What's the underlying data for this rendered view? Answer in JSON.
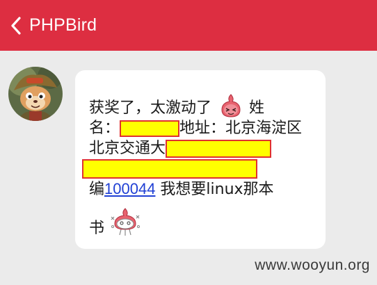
{
  "header": {
    "title": "PHPBird",
    "back_icon": "chevron-left-icon",
    "bg_color": "#dd2e41"
  },
  "message": {
    "line1_text": "获奖了，太激动了",
    "line1_tail": "姓",
    "line2_prefix": "名：",
    "line2_suffix": "地址：北京海淀区",
    "line3_prefix": "北京交通大",
    "line5_prefix": "编",
    "postcode_link": "100044",
    "line5_suffix": " 我想要linux那本",
    "line6_text": "书",
    "emoji1": "onion-excited-emoji",
    "emoji2": "onion-dizzy-emoji",
    "redaction_color": "#ffff00"
  },
  "watermark": "www.wooyun.org"
}
